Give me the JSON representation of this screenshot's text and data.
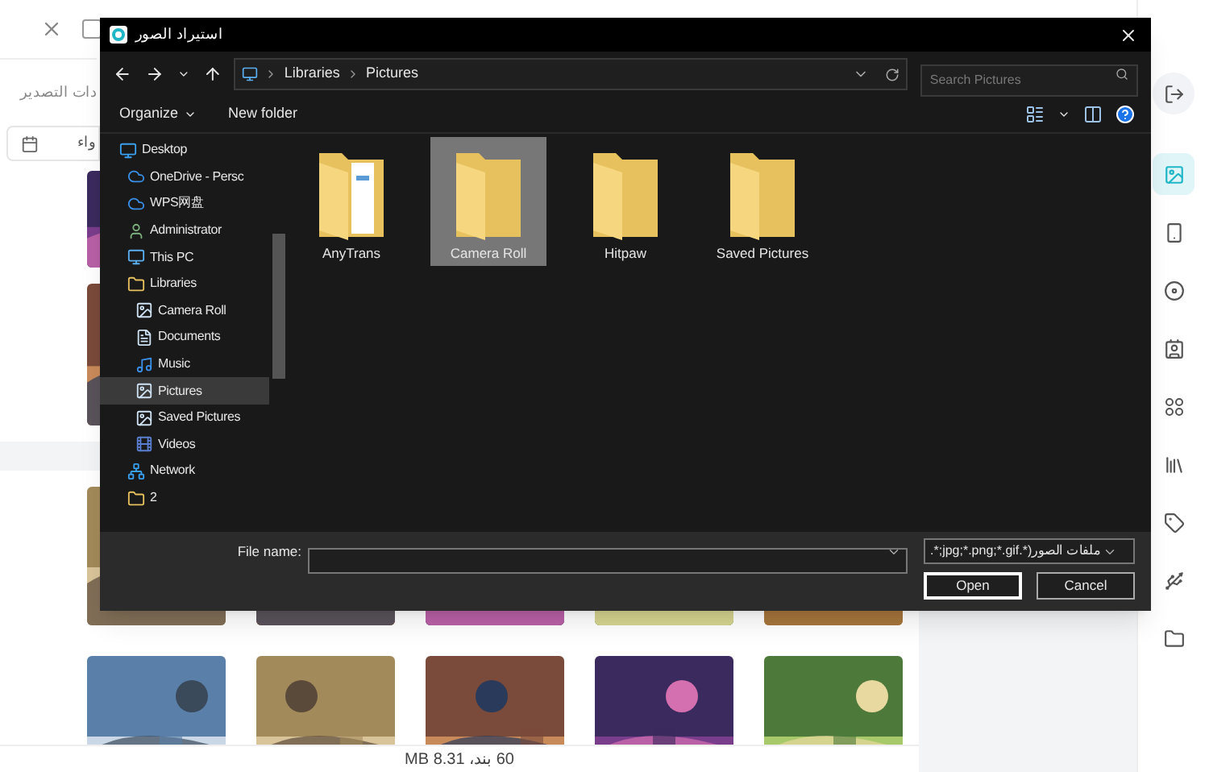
{
  "app": {
    "export_settings_label": "دات التصدير",
    "date_field_value": "واء",
    "footer_summary": "60 بند، 8.31 MB",
    "sidebar": [
      {
        "kind": "logout",
        "selected": false
      },
      {
        "kind": "photos",
        "selected": true
      },
      {
        "kind": "device",
        "selected": false
      },
      {
        "kind": "disc",
        "selected": false
      },
      {
        "kind": "contacts",
        "selected": false
      },
      {
        "kind": "apps",
        "selected": false
      },
      {
        "kind": "books",
        "selected": false
      },
      {
        "kind": "tag",
        "selected": false
      },
      {
        "kind": "usb",
        "selected": false
      },
      {
        "kind": "folder",
        "selected": false
      }
    ]
  },
  "dialog": {
    "title": "استيراد الصور",
    "breadcrumb": [
      "Libraries",
      "Pictures"
    ],
    "search": {
      "placeholder": "Search Pictures"
    },
    "commands": [
      "Organize",
      "New folder"
    ],
    "nav_tree": [
      {
        "label": "Desktop",
        "kind": "desktop",
        "selected": false,
        "children": [
          {
            "label": "OneDrive - Persc",
            "kind": "cloud",
            "selected": false
          },
          {
            "label": "WPS网盘",
            "kind": "cloud",
            "selected": false
          },
          {
            "label": "Administrator",
            "kind": "user",
            "selected": false
          },
          {
            "label": "This PC",
            "kind": "pc",
            "selected": false
          },
          {
            "label": "Libraries",
            "kind": "library",
            "selected": false,
            "children": [
              {
                "label": "Camera Roll",
                "kind": "pictures",
                "selected": false
              },
              {
                "label": "Documents",
                "kind": "documents",
                "selected": false
              },
              {
                "label": "Music",
                "kind": "music",
                "selected": false
              },
              {
                "label": "Pictures",
                "kind": "pictures",
                "selected": true
              },
              {
                "label": "Saved Pictures",
                "kind": "pictures",
                "selected": false
              },
              {
                "label": "Videos",
                "kind": "videos",
                "selected": false
              }
            ]
          },
          {
            "label": "Network",
            "kind": "network",
            "selected": false
          },
          {
            "label": "2",
            "kind": "folder",
            "selected": false
          }
        ]
      }
    ],
    "folders": [
      {
        "name": "AnyTrans",
        "kind": "documents",
        "selected": false
      },
      {
        "name": "Camera Roll",
        "kind": "plain",
        "selected": true
      },
      {
        "name": "Hitpaw",
        "kind": "plain",
        "selected": false
      },
      {
        "name": "Saved Pictures",
        "kind": "plain",
        "selected": false
      }
    ],
    "file_name_label": "File name:",
    "file_type": "ملفات الصور(*.jpg;*.png;*.gif;*.",
    "buttons": [
      "Open",
      "Cancel"
    ]
  }
}
